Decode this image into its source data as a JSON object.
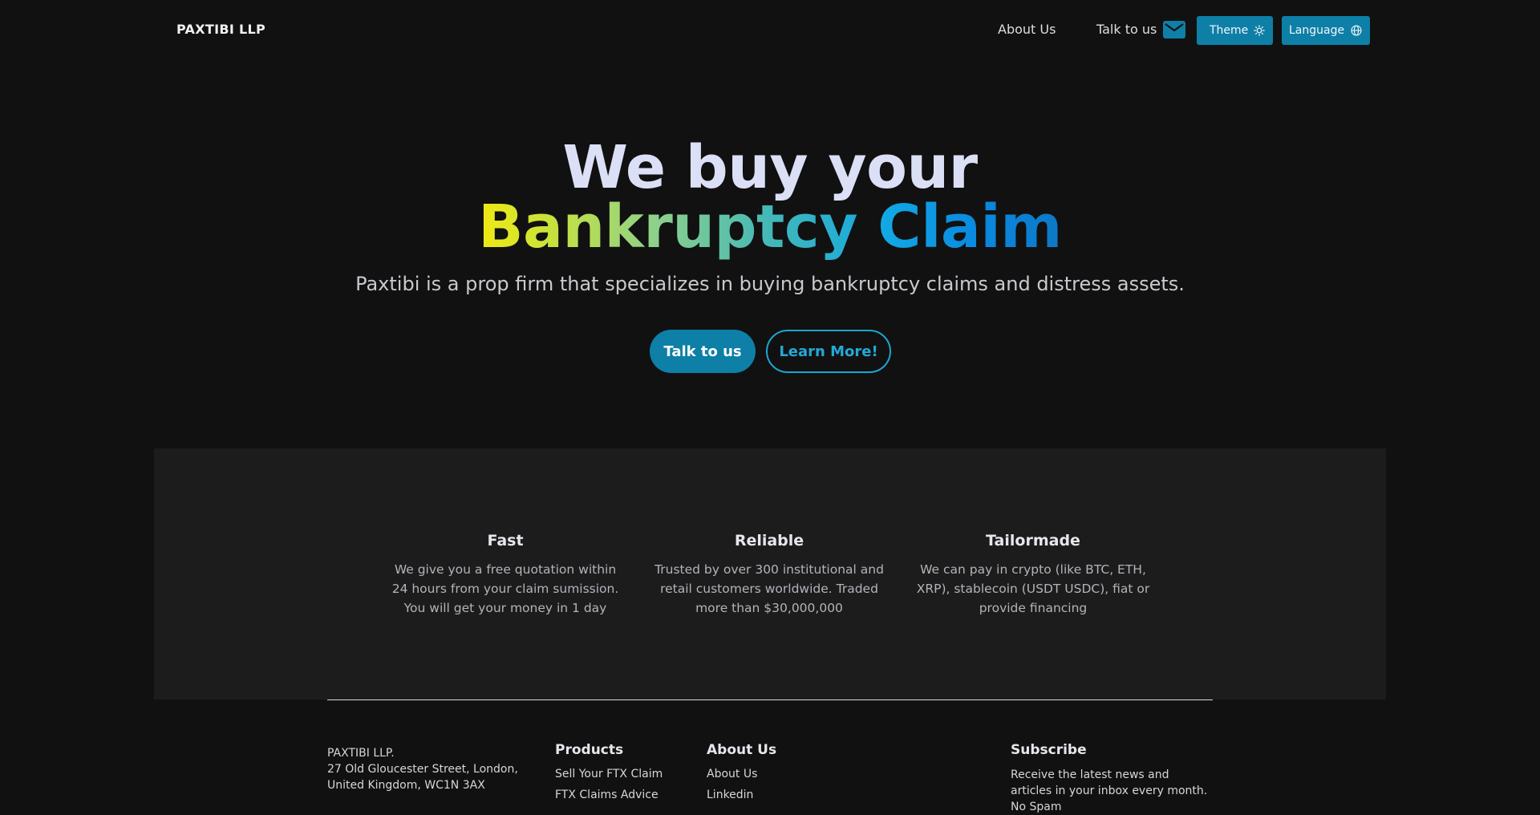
{
  "nav": {
    "brand": "PAXTIBI LLP",
    "about_label": "About Us",
    "talk_label": "Talk to us",
    "theme_label": "Theme",
    "language_label": "Language"
  },
  "hero": {
    "title_line1": "We buy your",
    "title_line2": "Bankruptcy Claim",
    "subtitle": "Paxtibi is a prop firm that specializes in buying bankruptcy claims and distress assets.",
    "primary_cta": "Talk to us",
    "secondary_cta": "Learn More!"
  },
  "features": [
    {
      "title": "Fast",
      "text": "We give you a free quotation within 24 hours from your claim sumission. You will get your money in 1 day"
    },
    {
      "title": "Reliable",
      "text": "Trusted by over 300 institutional and retail customers worldwide. Traded more than $30,000,000"
    },
    {
      "title": "Tailormade",
      "text": "We can pay in crypto (like BTC, ETH, XRP), stablecoin (USDT USDC), fiat or provide financing"
    }
  ],
  "footer": {
    "address_lines": [
      "PAXTIBI LLP.",
      "27 Old Gloucester Street, London,",
      "United Kingdom, WC1N 3AX"
    ],
    "products": {
      "heading": "Products",
      "links": [
        "Sell Your FTX Claim",
        "FTX Claims Advice"
      ]
    },
    "about": {
      "heading": "About Us",
      "links": [
        "About Us",
        "Linkedin"
      ]
    },
    "subscribe": {
      "heading": "Subscribe",
      "text": "Receive the latest news and articles in your inbox every month. No Spam"
    }
  },
  "colors": {
    "background": "#111111",
    "accent": "#0e7fa6",
    "features_bg": "#1c1c1d"
  },
  "icons": [
    "mail-icon",
    "sun-icon",
    "globe-icon"
  ]
}
